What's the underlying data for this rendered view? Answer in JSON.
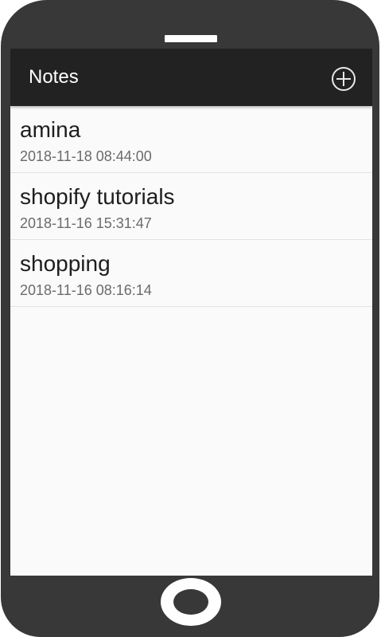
{
  "app_bar": {
    "title": "Notes",
    "add_icon": "plus-circle-icon"
  },
  "notes": [
    {
      "title": "amina",
      "date": "2018-11-18 08:44:00"
    },
    {
      "title": "shopify tutorials",
      "date": "2018-11-16 15:31:47"
    },
    {
      "title": "shopping",
      "date": "2018-11-16 08:16:14"
    }
  ],
  "colors": {
    "app_bar_bg": "#222222",
    "phone_frame": "#383838",
    "screen_bg": "#fafafa",
    "title_text": "#1e1e1e",
    "date_text": "#6b6b6b"
  }
}
